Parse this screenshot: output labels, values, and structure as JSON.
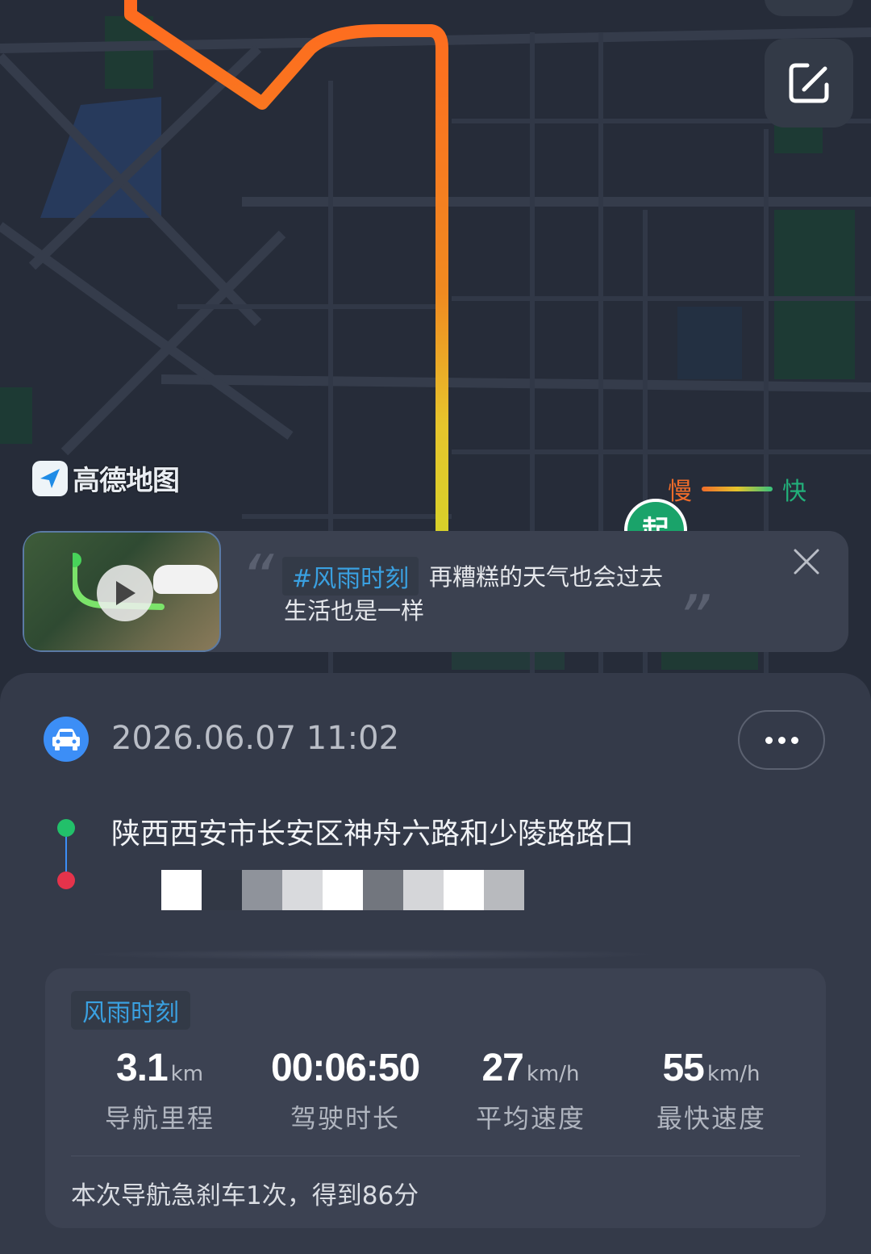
{
  "map": {
    "brand": "高德地图",
    "legend": {
      "slow": "慢",
      "fast": "快"
    },
    "start_marker": "起",
    "colors": {
      "route_start": "#ff6a1f",
      "route_mid": "#e6c52c",
      "map_bg": "#262c39"
    }
  },
  "banner": {
    "tag": "#风雨时刻",
    "line1": "再糟糕的天气也会过去",
    "line2": "生活也是一样"
  },
  "trip": {
    "datetime": "2026.06.07 11:02",
    "from": "陕西西安市长安区神舟六路和少陵路路口"
  },
  "stats": {
    "tag": "风雨时刻",
    "items": [
      {
        "value": "3.1",
        "unit": "km",
        "label": "导航里程"
      },
      {
        "value": "00:06:50",
        "unit": "",
        "label": "驾驶时长"
      },
      {
        "value": "27",
        "unit": "km/h",
        "label": "平均速度"
      },
      {
        "value": "55",
        "unit": "km/h",
        "label": "最快速度"
      }
    ],
    "summary": "本次导航急刹车1次，得到86分"
  }
}
